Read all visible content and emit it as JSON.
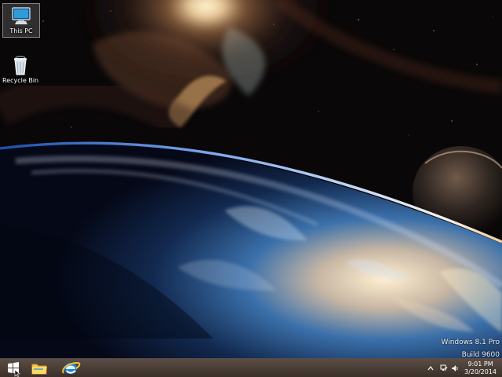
{
  "desktop": {
    "icons": [
      {
        "label": "This PC",
        "icon": "computer-icon",
        "selected": true
      },
      {
        "label": "Recycle Bin",
        "icon": "recycle-bin-icon",
        "selected": false
      }
    ],
    "watermark": {
      "edition": "Windows 8.1 Pro",
      "build": "Build 9600"
    }
  },
  "taskbar": {
    "buttons": [
      {
        "name": "start",
        "icon": "windows-logo-icon"
      },
      {
        "name": "file-explorer",
        "icon": "folder-icon"
      },
      {
        "name": "internet-explorer",
        "icon": "internet-explorer-icon"
      }
    ],
    "tray": {
      "icons": [
        "up-arrow-icon",
        "network-icon",
        "speaker-icon"
      ],
      "time": "9:01 PM",
      "date": "3/20/2014"
    }
  },
  "colors": {
    "taskbar": "#4a3d36",
    "text": "#ffffff",
    "accent": "#2f9bd7"
  }
}
